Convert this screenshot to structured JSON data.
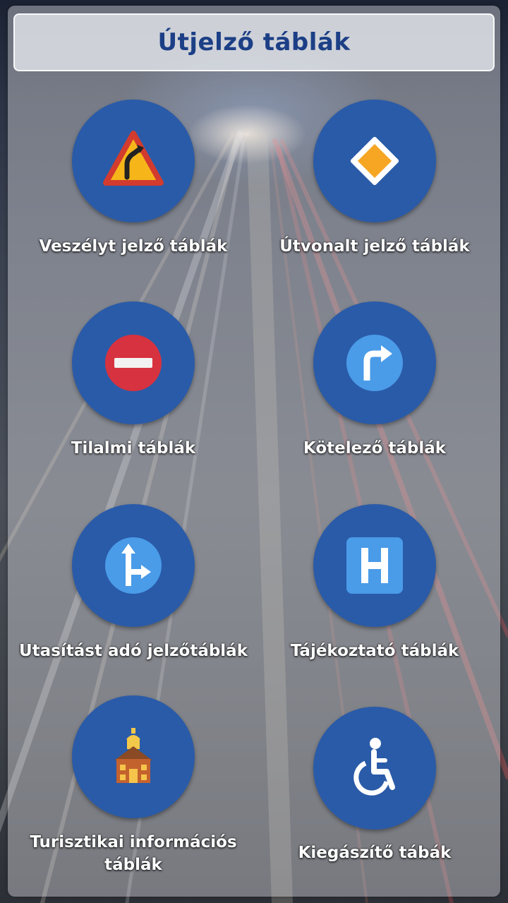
{
  "header": {
    "title": "Útjelző táblák"
  },
  "colors": {
    "title_text": "#1c3f86",
    "circle_bg": "#2a5ba8",
    "label_text": "#ffffff"
  },
  "categories": [
    {
      "label": "Veszélyt jelző táblák",
      "icon": "warning-curve-sign-icon"
    },
    {
      "label": "Útvonalt jelző táblák",
      "icon": "priority-road-sign-icon"
    },
    {
      "label": "Tilalmi táblák",
      "icon": "no-entry-sign-icon"
    },
    {
      "label": "Kötelező táblák",
      "icon": "mandatory-turn-right-sign-icon"
    },
    {
      "label": "Utasítást adó jelzőtáblák",
      "icon": "direction-arrows-sign-icon"
    },
    {
      "label": "Tájékoztató táblák",
      "icon": "hospital-h-sign-icon"
    },
    {
      "label": "Turisztikai információs táblák",
      "icon": "church-building-icon"
    },
    {
      "label": "Kiegászítő tábák",
      "icon": "wheelchair-icon"
    }
  ]
}
